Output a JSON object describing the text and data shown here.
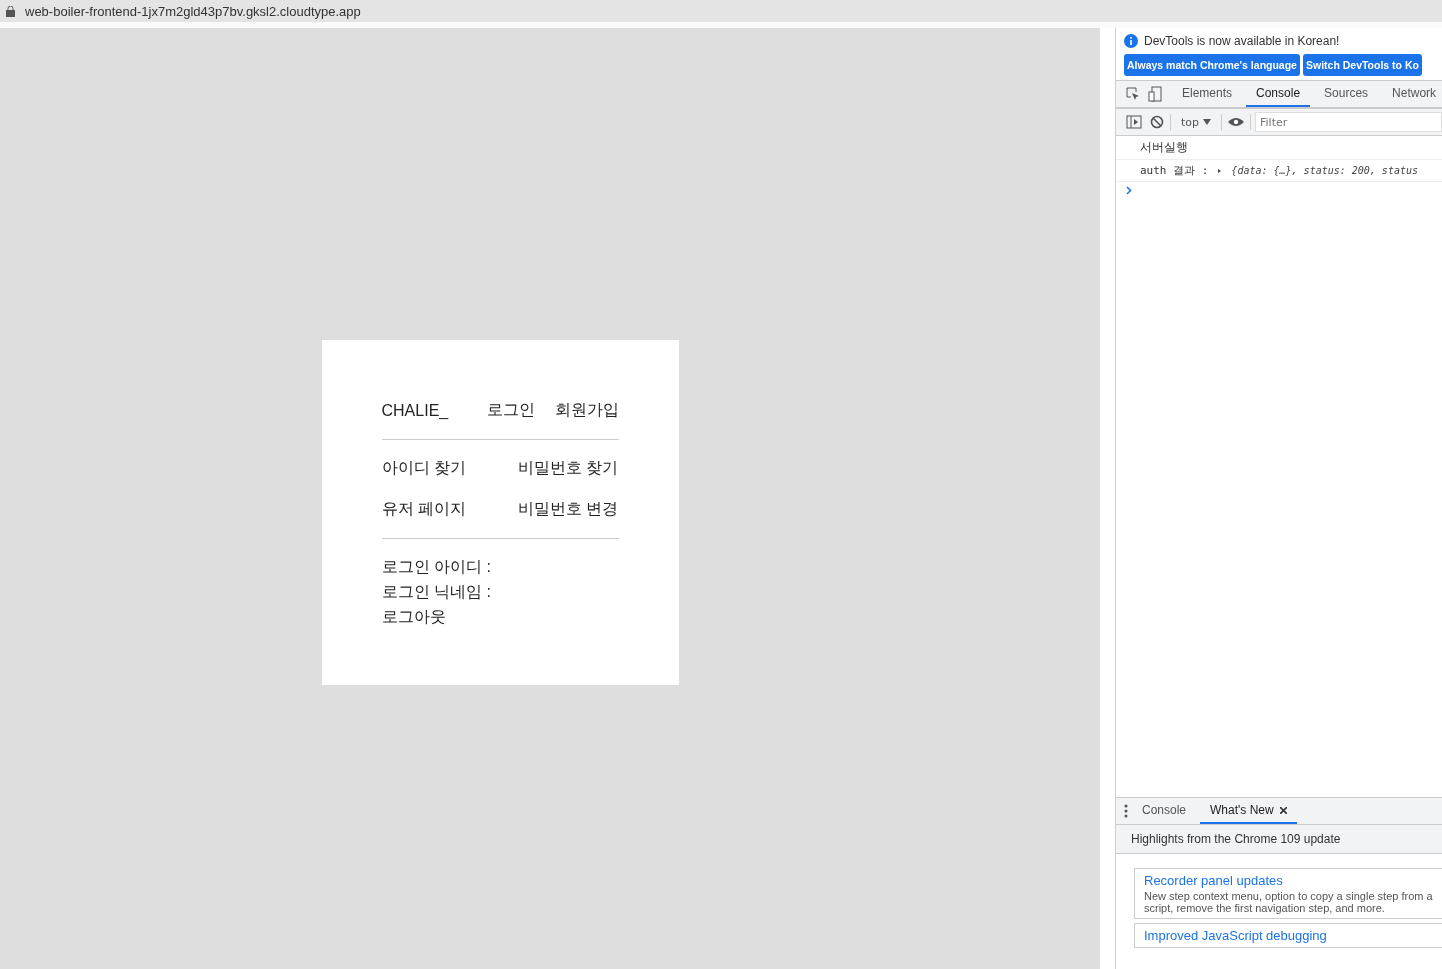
{
  "address_bar": {
    "url": "web-boiler-frontend-1jx7m2gld43p7bv.gksl2.cloudtype.app"
  },
  "page": {
    "brand": "CHALIE_",
    "nav": [
      "로그인",
      "회원가입"
    ],
    "links": [
      {
        "left": "아이디 찾기",
        "right": "비밀번호 찾기"
      },
      {
        "left": "유저 페이지",
        "right": "비밀번호 변경"
      }
    ],
    "info": [
      "로그인 아이디 :",
      "로그인 닉네임 :",
      "로그아웃"
    ]
  },
  "devtools": {
    "notice": "DevTools is now available in Korean!",
    "notice_buttons": [
      "Always match Chrome's language",
      "Switch DevTools to Ko"
    ],
    "tabs": [
      {
        "label": "Elements",
        "selected": false
      },
      {
        "label": "Console",
        "selected": true
      },
      {
        "label": "Sources",
        "selected": false
      },
      {
        "label": "Network",
        "selected": false
      }
    ],
    "context": "top",
    "filter_placeholder": "Filter",
    "console_lines": [
      {
        "kind": "text",
        "text": "서버실행"
      },
      {
        "kind": "object",
        "label": "auth 결과 :",
        "preview": "{data: {…}, status: 200, status"
      }
    ],
    "drawer_tabs": [
      {
        "label": "Console",
        "selected": false
      },
      {
        "label": "What's New",
        "selected": true
      }
    ],
    "highlights": "Highlights from the Chrome 109 update",
    "cards": [
      {
        "title": "Recorder panel updates",
        "body": "New step context menu, option to copy a single step from a script, remove the first navigation step, and more."
      },
      {
        "title": "Improved JavaScript debugging"
      }
    ]
  }
}
